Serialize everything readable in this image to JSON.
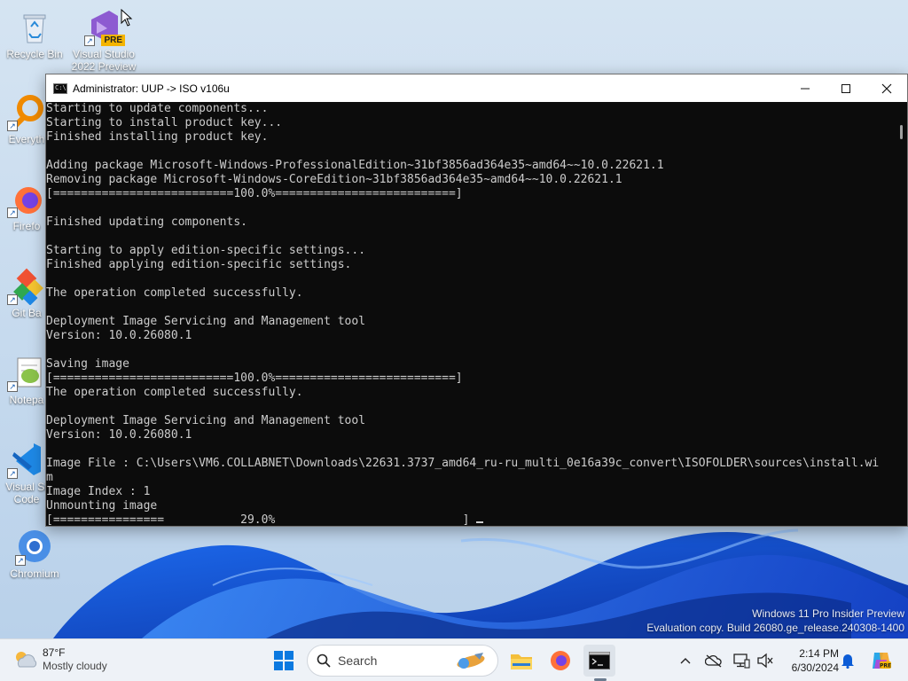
{
  "desktop": {
    "icons": [
      {
        "label": "Recycle Bin",
        "icon": "recycle-bin-icon"
      },
      {
        "label": "Visual Studio 2022 Preview",
        "badge": "PRE",
        "icon": "visual-studio-preview-icon"
      },
      {
        "label": "Everyth",
        "icon": "everything-search-icon"
      },
      {
        "label": "Firefo",
        "icon": "firefox-icon"
      },
      {
        "label": "Git Ba",
        "icon": "git-bash-icon"
      },
      {
        "label": "Notepa",
        "icon": "notepad-plus-plus-icon"
      },
      {
        "label": "Visual St Code",
        "icon": "vscode-icon"
      },
      {
        "label": "Chromium",
        "icon": "chromium-icon"
      }
    ]
  },
  "console": {
    "title": "Administrator:  UUP -> ISO v106u",
    "lines": [
      "Starting to update components...",
      "Starting to install product key...",
      "Finished installing product key.",
      "",
      "Adding package Microsoft-Windows-ProfessionalEdition~31bf3856ad364e35~amd64~~10.0.22621.1",
      "Removing package Microsoft-Windows-CoreEdition~31bf3856ad364e35~amd64~~10.0.22621.1",
      "[==========================100.0%==========================]",
      "",
      "Finished updating components.",
      "",
      "Starting to apply edition-specific settings...",
      "Finished applying edition-specific settings.",
      "",
      "The operation completed successfully.",
      "",
      "Deployment Image Servicing and Management tool",
      "Version: 10.0.26080.1",
      "",
      "Saving image",
      "[==========================100.0%==========================]",
      "The operation completed successfully.",
      "",
      "Deployment Image Servicing and Management tool",
      "Version: 10.0.26080.1",
      "",
      "Image File : C:\\Users\\VM6.COLLABNET\\Downloads\\22631.3737_amd64_ru-ru_multi_0e16a39c_convert\\ISOFOLDER\\sources\\install.wi",
      "m",
      "Image Index : 1",
      "Unmounting image",
      "[================           29.0%                           ] "
    ],
    "progress_fraction": 0.29
  },
  "watermark": {
    "line1": "Windows 11 Pro Insider Preview",
    "line2": "Evaluation copy. Build 26080.ge_release.240308-1400"
  },
  "taskbar": {
    "weather_temp": "87°F",
    "weather_condition": "Mostly cloudy",
    "search_placeholder": "Search",
    "time": "2:14 PM",
    "date": "6/30/2024"
  },
  "colors": {
    "console_bg": "#0c0c0c",
    "console_fg": "#cccccc",
    "taskbar_bg": "#eef2f7",
    "accent_blue": "#0b5cd6"
  }
}
